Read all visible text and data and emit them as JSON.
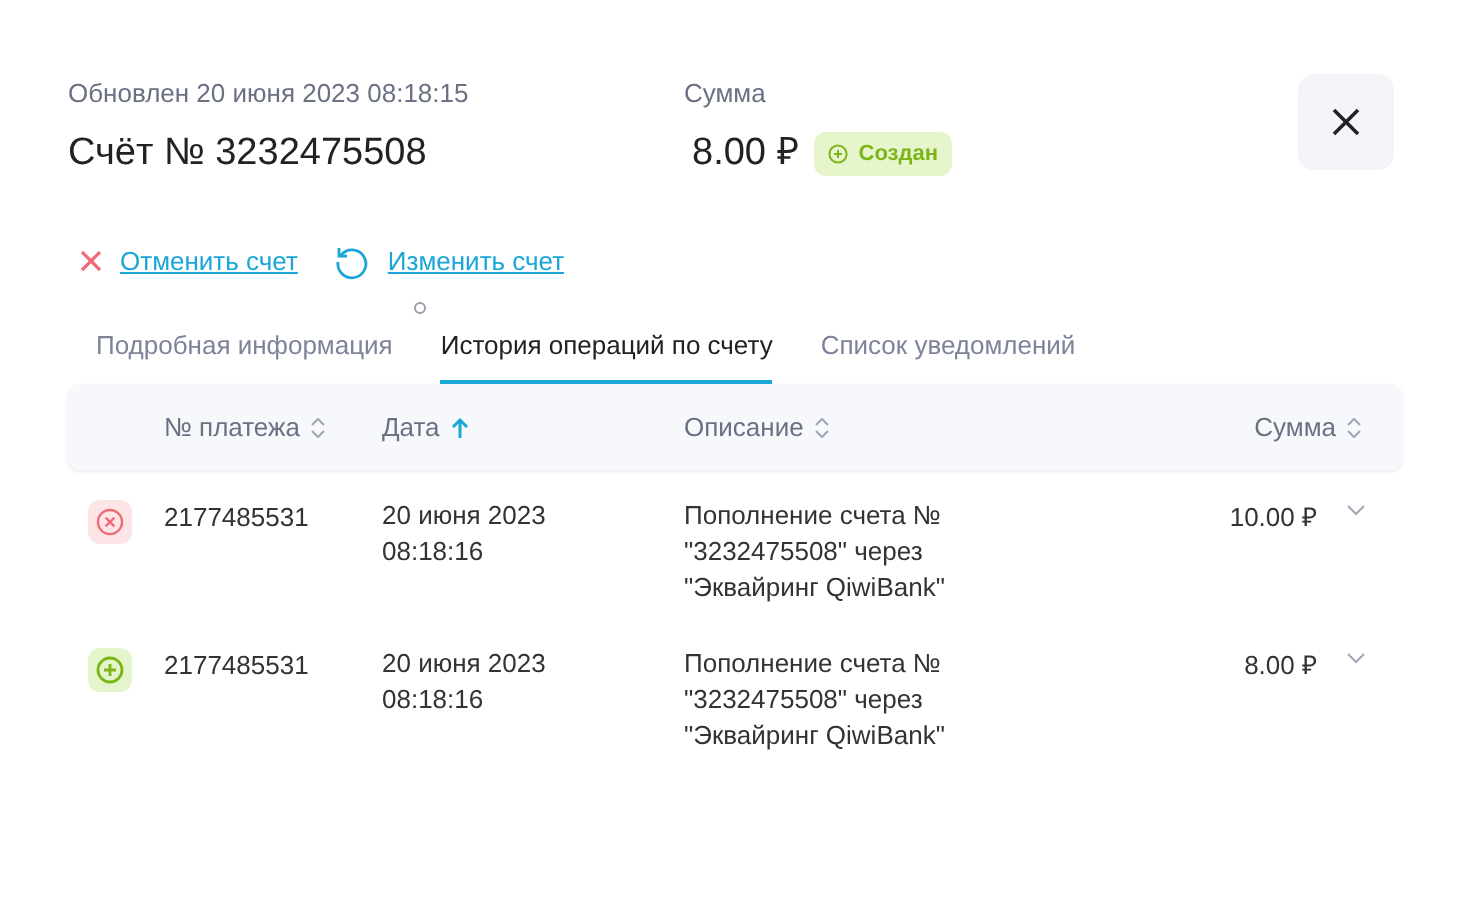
{
  "header": {
    "updated": "Обновлен 20 июня 2023 08:18:15",
    "title": "Счёт № 3232475508",
    "amount_label": "Сумма",
    "amount": "8.00 ₽",
    "status": {
      "label": "Создан",
      "kind": "created"
    }
  },
  "actions": [
    {
      "label": "Отменить счет",
      "kind": "cancel"
    },
    {
      "label": "Изменить счет",
      "kind": "edit"
    }
  ],
  "tabs": [
    {
      "label": "Подробная информация",
      "selected": false
    },
    {
      "label": "История операций по счету",
      "selected": true
    },
    {
      "label": "Список уведомлений",
      "selected": false
    }
  ],
  "table": {
    "columns": [
      {
        "label": "№ платежа",
        "sorted": false
      },
      {
        "label": "Дата",
        "sorted": true
      },
      {
        "label": "Описание",
        "sorted": false
      },
      {
        "label": "Сумма",
        "sorted": false
      }
    ],
    "rows": [
      {
        "kind": "failed",
        "number": "2177485531",
        "date": "20 июня 2023 08:18:16",
        "description": "Пополнение счета № \"3232475508\" через \"Эквайринг QiwiBank\"",
        "amount": "10.00 ₽",
        "expanded": false
      },
      {
        "kind": "success",
        "number": "2177485531",
        "date": "20 июня 2023 08:18:16",
        "description": "Пополнение счета № \"3232475508\" через \"Эквайринг QiwiBank\"",
        "amount": "8.00 ₽",
        "expanded": false
      }
    ]
  }
}
